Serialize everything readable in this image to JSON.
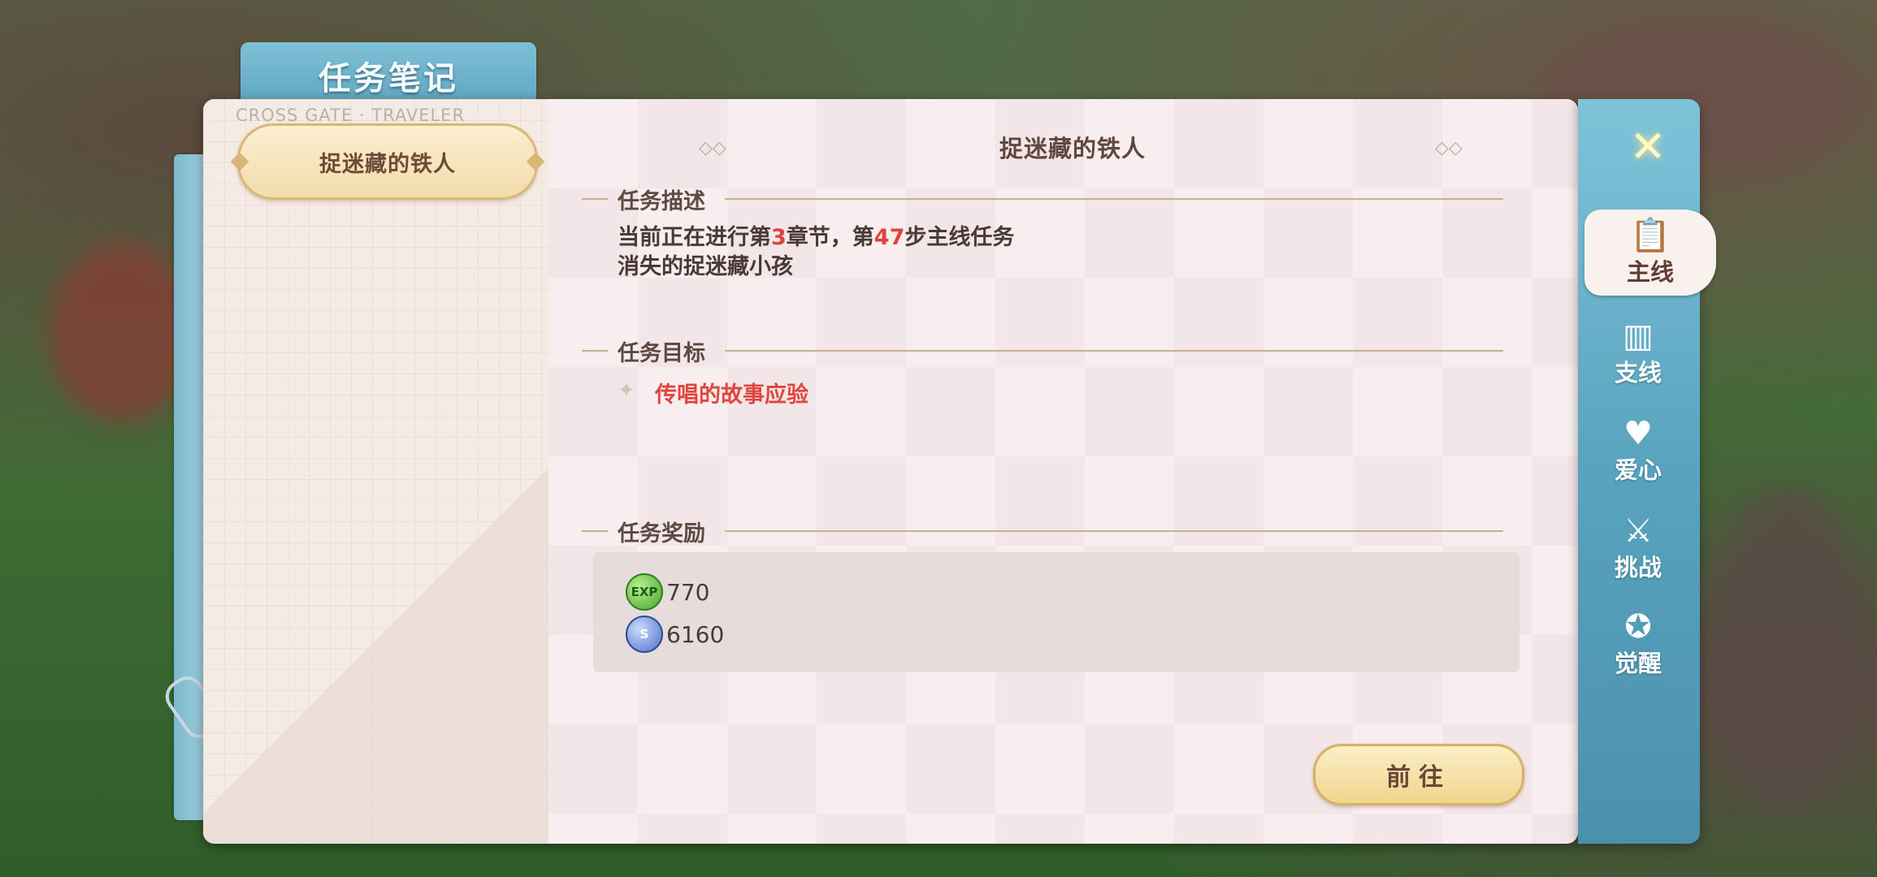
{
  "book": {
    "title": "任务笔记",
    "subtitle": "CROSS GATE · TRAVELER"
  },
  "quest_list": {
    "items": [
      {
        "label": "捉迷藏的铁人",
        "selected": true
      }
    ]
  },
  "detail": {
    "title": "捉迷藏的铁人",
    "description": {
      "heading": "任务描述",
      "line1_prefix": "当前正在进行第",
      "chapter": "3",
      "line1_mid": "章节，第",
      "step": "47",
      "line1_suffix": "步主线任务",
      "line2": "消失的捉迷藏小孩"
    },
    "goal": {
      "heading": "任务目标",
      "text": "传唱的故事应验"
    },
    "reward": {
      "heading": "任务奖励",
      "items": [
        {
          "icon": "exp-icon",
          "icon_text": "EXP",
          "value": "770"
        },
        {
          "icon": "coin-icon",
          "icon_text": "S",
          "value": "6160"
        }
      ]
    },
    "go_button": "前往"
  },
  "sidebar": {
    "tabs": [
      {
        "label": "主线",
        "icon": "clipboard-icon",
        "active": true
      },
      {
        "label": "支线",
        "icon": "notebook-icon",
        "active": false
      },
      {
        "label": "爱心",
        "icon": "heart-icon",
        "active": false
      },
      {
        "label": "挑战",
        "icon": "crossed-swords-icon",
        "active": false
      },
      {
        "label": "觉醒",
        "icon": "awaken-icon",
        "active": false
      }
    ]
  },
  "colors": {
    "accent_red": "#e2423d",
    "sidebar_blue": "#58a3bf",
    "button_gold": "#f0d58d"
  }
}
